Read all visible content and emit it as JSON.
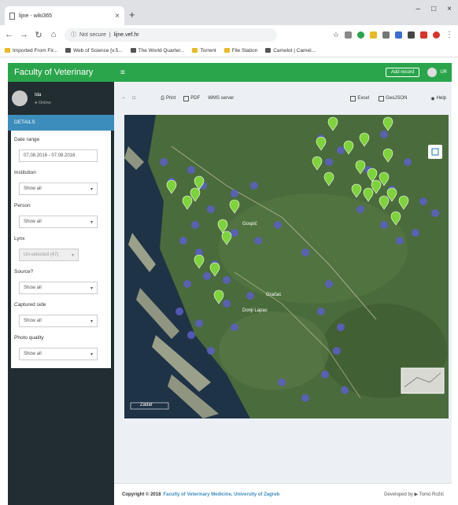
{
  "browser": {
    "tab_title": "lijne - wiki365",
    "url_prefix": "Not secure",
    "url": "lijne.vef.hr",
    "bookmarks": [
      "Imported From Fir...",
      "Web of Science [v.5...",
      "The World Quarter...",
      "Torrent",
      "File Station",
      "Camelot | Camel..."
    ]
  },
  "header": {
    "brand": "Faculty of Veterinary",
    "menu_icon": "hamburger-icon",
    "action_label": "Add record",
    "user_label": "UR"
  },
  "sidebar": {
    "user_name": "Ida",
    "user_status": "● Online",
    "filter_heading": "DETAILS",
    "filters": [
      {
        "label": "Date range",
        "value": "07.08.2016 - 07.08.2018",
        "caret": ""
      },
      {
        "label": "Institution",
        "value": "Show all",
        "caret": "▾"
      },
      {
        "label": "Person",
        "value": "Show all",
        "caret": "▾"
      },
      {
        "label": "Lynx",
        "value": "Un-selected (47)",
        "caret": "▾"
      },
      {
        "label": "Source?",
        "value": "Show all",
        "caret": "▾"
      },
      {
        "label": "Captured side",
        "value": "Show all",
        "caret": "▾"
      },
      {
        "label": "Photo quality",
        "value": "Show all",
        "caret": "▾"
      }
    ]
  },
  "toolbar": {
    "zoom_out": "−",
    "toggle": "□",
    "print_label": "Print",
    "pdf_label": "PDF",
    "wms_label": "WMS server",
    "excel_label": "Excel",
    "geojson_label": "GeoJSON",
    "help_label": "Help"
  },
  "map": {
    "land_color": "#4a6b3c",
    "sea_color": "#1f3347",
    "green_marker_color": "#7ed23a",
    "blue_marker_color": "#5b5fc7",
    "place_labels": [
      "Gospić",
      "Gračac",
      "Donji Lapac",
      "Zadar"
    ]
  },
  "footer": {
    "copyright_prefix": "Copyright © 2018",
    "institution": "Faculty of Veterinary Medicine, University of Zagreb",
    "developed_by": "Developed by ▶ Tomo Rožić"
  }
}
